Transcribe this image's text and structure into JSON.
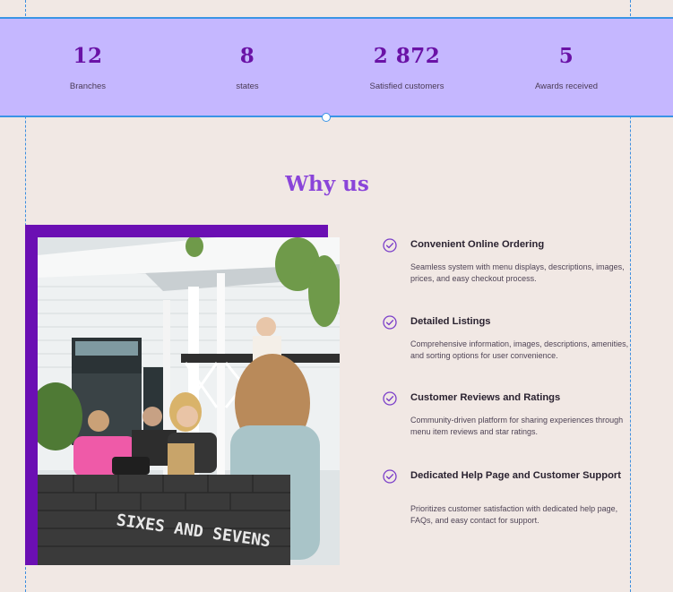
{
  "stats": [
    {
      "number": "12",
      "label": "Branches"
    },
    {
      "number": "8",
      "label": "states"
    },
    {
      "number": "2 872",
      "label": "Satisfied customers"
    },
    {
      "number": "5",
      "label": "Awards received"
    }
  ],
  "why_us": {
    "title": "Why us",
    "photo_sign_text": "SIXES AND SEVENS",
    "features": [
      {
        "title": "Convenient Online Ordering",
        "description": "Seamless system with menu displays, descriptions, images, prices, and easy checkout process."
      },
      {
        "title": "Detailed Listings",
        "description": "Comprehensive information, images, descriptions, amenities, and sorting options for user convenience."
      },
      {
        "title": "Customer Reviews and Ratings",
        "description": "Community-driven platform for sharing experiences through menu item reviews and star ratings."
      },
      {
        "title": "Dedicated Help Page and Customer Support",
        "description": "Prioritizes customer satisfaction with dedicated help page, FAQs, and easy contact for support."
      }
    ]
  },
  "colors": {
    "page_background": "#f1e8e4",
    "stats_band": "#c5b7ff",
    "accent_purple": "#6b0fb3",
    "heading_purple": "#8a44d9",
    "guide_blue": "#3a94e6"
  }
}
